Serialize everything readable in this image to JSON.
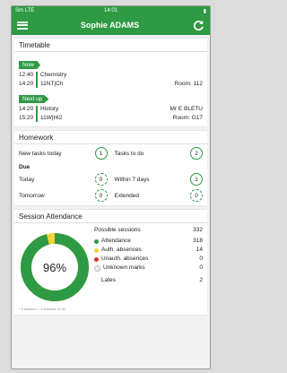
{
  "status": {
    "left": "Sm LTE",
    "time": "14:01",
    "right": "▮"
  },
  "appbar": {
    "title": "Sophie ADAMS"
  },
  "timetable": {
    "title": "Timetable",
    "now_label": "Now",
    "now": {
      "start": "12:40",
      "end": "14:20",
      "subject": "Chemistry",
      "group": "11NT|Ch",
      "teacher": "",
      "room": "Room: 112"
    },
    "next_label": "Next up",
    "next": {
      "start": "14:20",
      "end": "15:20",
      "subject": "History",
      "group": "11W|Hi2",
      "teacher": "Mr E BLETU",
      "room": "Room: G17"
    }
  },
  "homework": {
    "title": "Homework",
    "new_tasks_label": "New tasks today",
    "new_tasks_value": "1",
    "tasks_to_do_label": "Tasks to do",
    "tasks_to_do_value": "2",
    "due_label": "Due",
    "today_label": "Today",
    "today_value": "0",
    "within7_label": "Within 7 days",
    "within7_value": "1",
    "tomorrow_label": "Tomorrow",
    "tomorrow_value": "0",
    "extended_label": "Extended",
    "extended_value": "0"
  },
  "attendance": {
    "title": "Session Attendance",
    "percent": "96%",
    "percent_value": 96,
    "possible_label": "Possible sessions",
    "possible_value": "332",
    "items": [
      {
        "label": "Attendance",
        "value": "318",
        "color": "#2e9a43"
      },
      {
        "label": "Auth. absences",
        "value": "14",
        "color": "#f2d43a"
      },
      {
        "label": "Unauth. absences",
        "value": "0",
        "color": "#d9322b"
      },
      {
        "label": "Unknown marks",
        "value": "0",
        "color": "#eeeeee"
      }
    ],
    "lates_label": "Lates",
    "lates_value": "2",
    "footnote": "* 1 session = 2 lessons  14:01"
  },
  "colors": {
    "accent": "#2e9a43"
  }
}
